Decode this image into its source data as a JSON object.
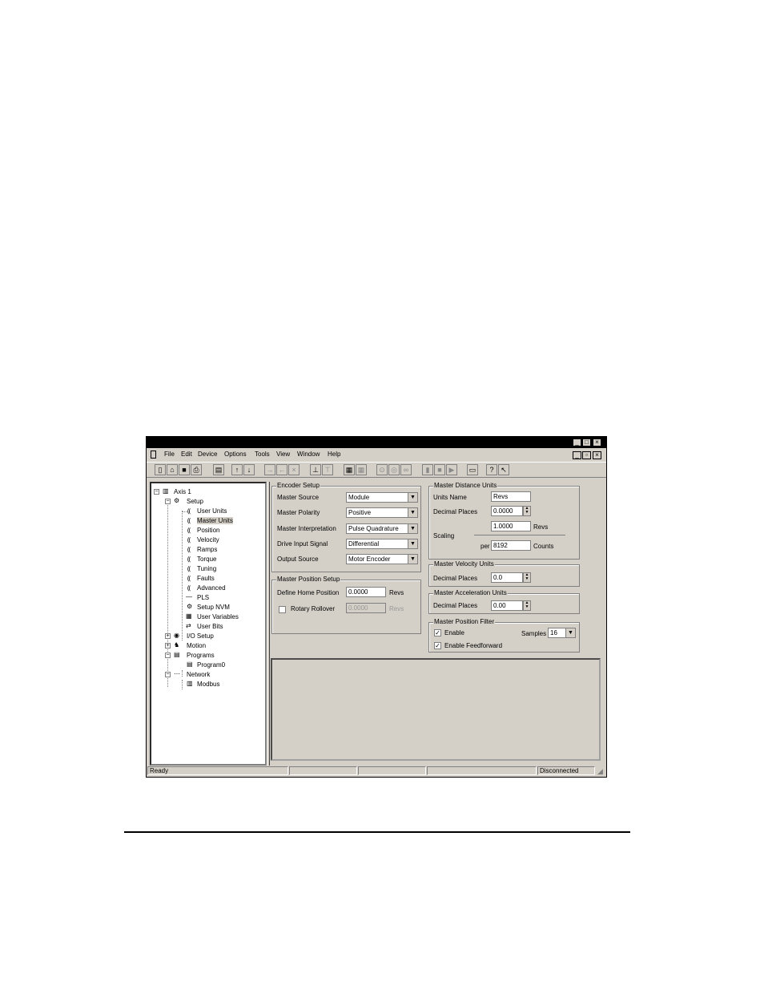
{
  "menu": [
    "File",
    "Edit",
    "Device",
    "Options",
    "Tools",
    "View",
    "Window",
    "Help"
  ],
  "window_buttons": {
    "minimize": "_",
    "maximize": "□",
    "close": "×",
    "restore": "▫"
  },
  "tree": {
    "root": "Axis 1",
    "setup": "Setup",
    "setup_children": [
      "User Units",
      "Master Units",
      "Position",
      "Velocity",
      "Ramps",
      "Torque",
      "Tuning",
      "Faults",
      "Advanced",
      "PLS",
      "Setup NVM",
      "User Variables",
      "User Bits"
    ],
    "io_setup": "I/O Setup",
    "motion": "Motion",
    "programs": "Programs",
    "program0": "Program0",
    "network": "Network",
    "modbus": "Modbus",
    "selected": "Master Units"
  },
  "encoder_setup": {
    "title": "Encoder Setup",
    "master_source_label": "Master Source",
    "master_source_value": "Module",
    "master_polarity_label": "Master Polarity",
    "master_polarity_value": "Positive",
    "master_interp_label": "Master Interpretation",
    "master_interp_value": "Pulse Quadrature",
    "drive_input_label": "Drive Input Signal",
    "drive_input_value": "Differential",
    "output_source_label": "Output Source",
    "output_source_value": "Motor Encoder"
  },
  "master_position_setup": {
    "title": "Master Position Setup",
    "define_home_label": "Define Home Position",
    "define_home_value": "0.0000",
    "define_home_unit": "Revs",
    "rotary_rollover_label": "Rotary Rollover",
    "rotary_rollover_value": "0.0000",
    "rotary_rollover_unit": "Revs"
  },
  "master_distance_units": {
    "title": "Master Distance Units",
    "units_name_label": "Units Name",
    "units_name_value": "Revs",
    "decimal_places_label": "Decimal Places",
    "decimal_places_value": "0.0000",
    "scaling_label": "Scaling",
    "scaling_value": "1.0000",
    "scaling_unit": "Revs",
    "per_label": "per",
    "per_value": "8192",
    "per_unit": "Counts"
  },
  "master_velocity_units": {
    "title": "Master Velocity Units",
    "decimal_places_label": "Decimal Places",
    "decimal_places_value": "0.0"
  },
  "master_acceleration_units": {
    "title": "Master Acceleration Units",
    "decimal_places_label": "Decimal Places",
    "decimal_places_value": "0.00"
  },
  "master_position_filter": {
    "title": "Master Position Filter",
    "enable_label": "Enable",
    "samples_label": "Samples",
    "samples_value": "16",
    "enable_ff_label": "Enable Feedforward"
  },
  "status": {
    "ready": "Ready",
    "connection": "Disconnected"
  }
}
